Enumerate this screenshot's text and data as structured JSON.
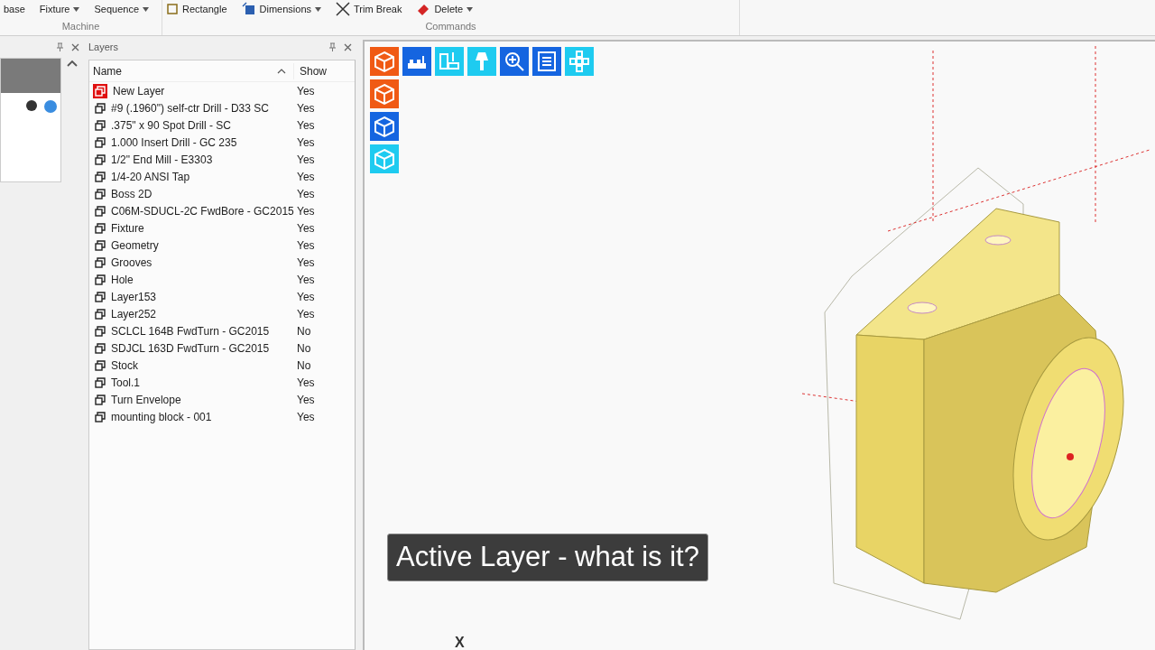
{
  "ribbon": {
    "groups": [
      {
        "label": "Machine",
        "buttons": [
          {
            "label": "base",
            "caret": false
          },
          {
            "label": "Fixture",
            "caret": true
          },
          {
            "label": "Sequence",
            "caret": true
          }
        ]
      },
      {
        "label": "Commands",
        "buttons": [
          {
            "label": "Rectangle",
            "caret": false,
            "kind": "rectangle"
          },
          {
            "label": "Dimensions",
            "caret": true,
            "kind": "dimensions"
          },
          {
            "label": "Trim Break",
            "caret": false,
            "kind": "trim"
          },
          {
            "label": "Delete",
            "caret": true,
            "kind": "delete"
          }
        ]
      }
    ]
  },
  "layers_panel": {
    "title": "Layers",
    "columns": [
      "Name",
      "Show"
    ],
    "rows": [
      {
        "name": "New Layer",
        "show": "Yes",
        "active": true
      },
      {
        "name": "#9 (.1960\") self-ctr Drill - D33 SC",
        "show": "Yes",
        "active": false
      },
      {
        "name": ".375\" x 90 Spot Drill - SC",
        "show": "Yes",
        "active": false
      },
      {
        "name": "1.000 Insert Drill - GC 235",
        "show": "Yes",
        "active": false
      },
      {
        "name": "1/2\" End Mill - E3303",
        "show": "Yes",
        "active": false
      },
      {
        "name": "1/4-20 ANSI Tap",
        "show": "Yes",
        "active": false
      },
      {
        "name": "Boss 2D",
        "show": "Yes",
        "active": false
      },
      {
        "name": "C06M-SDUCL-2C FwdBore - GC2015",
        "show": "Yes",
        "active": false
      },
      {
        "name": "Fixture",
        "show": "Yes",
        "active": false
      },
      {
        "name": "Geometry",
        "show": "Yes",
        "active": false
      },
      {
        "name": "Grooves",
        "show": "Yes",
        "active": false
      },
      {
        "name": "Hole",
        "show": "Yes",
        "active": false
      },
      {
        "name": "Layer153",
        "show": "Yes",
        "active": false
      },
      {
        "name": "Layer252",
        "show": "Yes",
        "active": false
      },
      {
        "name": "SCLCL 164B FwdTurn - GC2015",
        "show": "No",
        "active": false
      },
      {
        "name": "SDJCL 163D FwdTurn - GC2015",
        "show": "No",
        "active": false
      },
      {
        "name": "Stock",
        "show": "No",
        "active": false
      },
      {
        "name": "Tool.1",
        "show": "Yes",
        "active": false
      },
      {
        "name": "Turn Envelope",
        "show": "Yes",
        "active": false
      },
      {
        "name": "mounting block - 001",
        "show": "Yes",
        "active": false
      }
    ]
  },
  "viewport": {
    "toolbar": [
      {
        "kind": "cube",
        "color": "#f05a14"
      },
      {
        "kind": "machine",
        "color": "#1565e0"
      },
      {
        "kind": "mill",
        "color": "#1ecbf0"
      },
      {
        "kind": "tool",
        "color": "#1ecbf0"
      },
      {
        "kind": "zoom",
        "color": "#1565e0"
      },
      {
        "kind": "list",
        "color": "#1565e0"
      },
      {
        "kind": "grid",
        "color": "#1ecbf0"
      }
    ],
    "side_tools": [
      {
        "kind": "cube",
        "color": "#f05a14"
      },
      {
        "kind": "cube",
        "color": "#1565e0"
      },
      {
        "kind": "cube",
        "color": "#1ecbf0"
      }
    ],
    "caption": "Active Layer - what is it?",
    "axis_label": "X"
  }
}
